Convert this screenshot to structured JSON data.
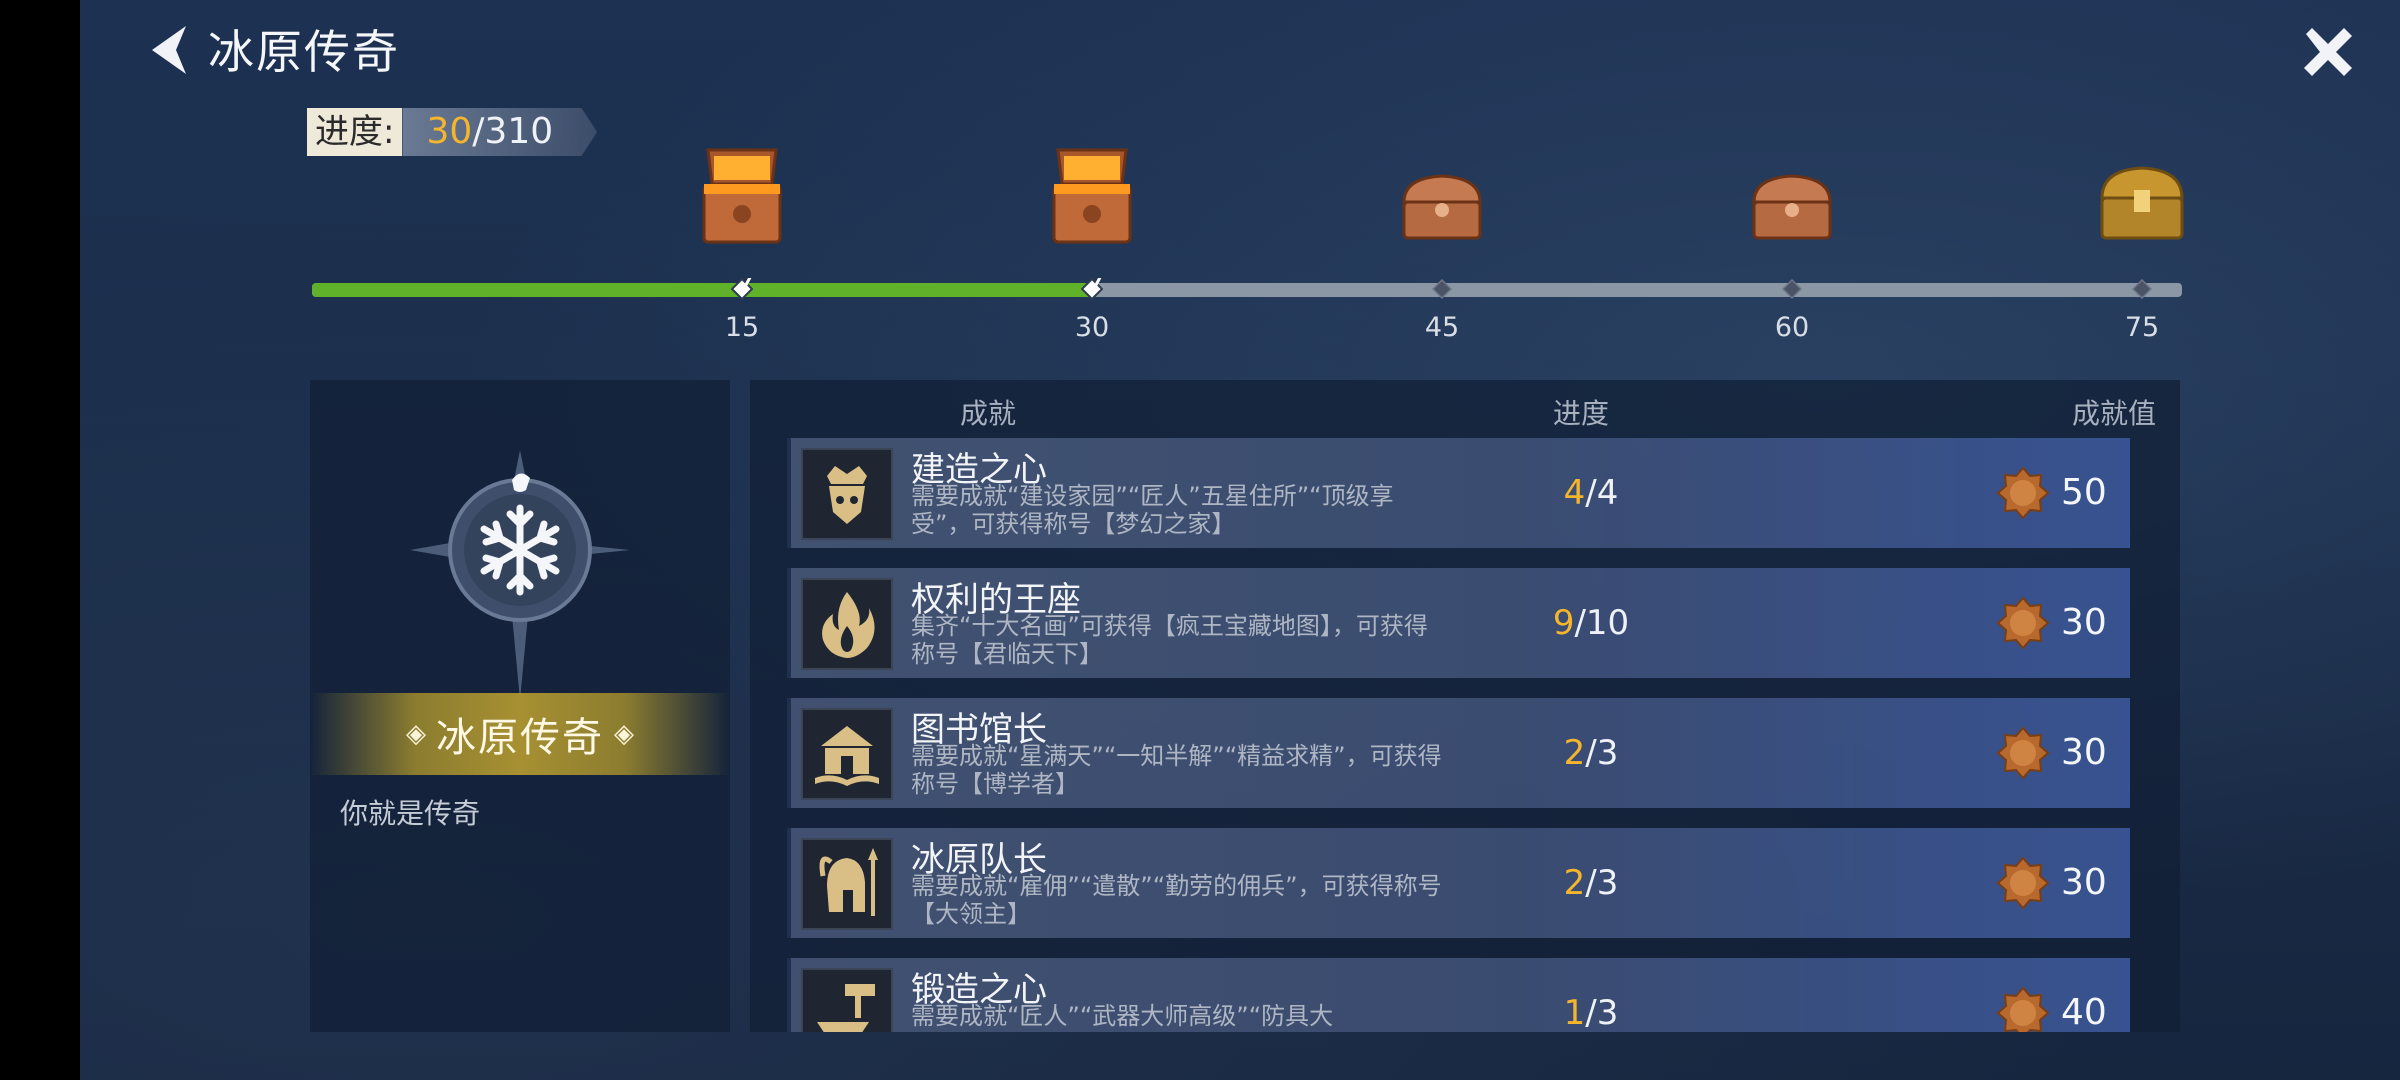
{
  "header": {
    "title": "冰原传奇"
  },
  "progress": {
    "label": "进度:",
    "current": "30",
    "total": "/310",
    "fraction": 0.37
  },
  "milestones": [
    {
      "value": "15",
      "reached": true,
      "chest": "open"
    },
    {
      "value": "30",
      "reached": true,
      "chest": "open"
    },
    {
      "value": "45",
      "reached": false,
      "chest": "closed-bronze"
    },
    {
      "value": "60",
      "reached": false,
      "chest": "closed-bronze"
    },
    {
      "value": "75",
      "reached": false,
      "chest": "closed-gold"
    }
  ],
  "legend": {
    "name": "冰原传奇",
    "description": "你就是传奇"
  },
  "table": {
    "headers": {
      "achievement": "成就",
      "progress": "进度",
      "points": "成就值"
    },
    "rows": [
      {
        "icon": "crowned-shield-icon",
        "title": "建造之心",
        "desc": "需要成就“建设家园”“匠人”五星住所”“顶级享受”，可获得称号【梦幻之家】",
        "have": "4",
        "need": "/4",
        "points": "50"
      },
      {
        "icon": "flame-icon",
        "title": "权利的王座",
        "desc": "集齐“十大名画”可获得【疯王宝藏地图】，可获得称号【君临天下】",
        "have": "9",
        "need": "/10",
        "points": "30"
      },
      {
        "icon": "library-icon",
        "title": "图书馆长",
        "desc": "需要成就“星满天”“一知半解”“精益求精”，可获得称号【博学者】",
        "have": "2",
        "need": "/3",
        "points": "30"
      },
      {
        "icon": "spartan-helmet-icon",
        "title": "冰原队长",
        "desc": "需要成就“雇佣”“遣散”“勤劳的佣兵”，可获得称号【大领主】",
        "have": "2",
        "need": "/3",
        "points": "30"
      },
      {
        "icon": "anvil-hammer-icon",
        "title": "锻造之心",
        "desc": "需要成就“匠人”“武器大师高级”“防具大",
        "have": "1",
        "need": "/3",
        "points": "40"
      }
    ]
  },
  "colors": {
    "accent": "#f5b52c",
    "progress_fill": "#5fb229",
    "track": "#8c97a6"
  }
}
